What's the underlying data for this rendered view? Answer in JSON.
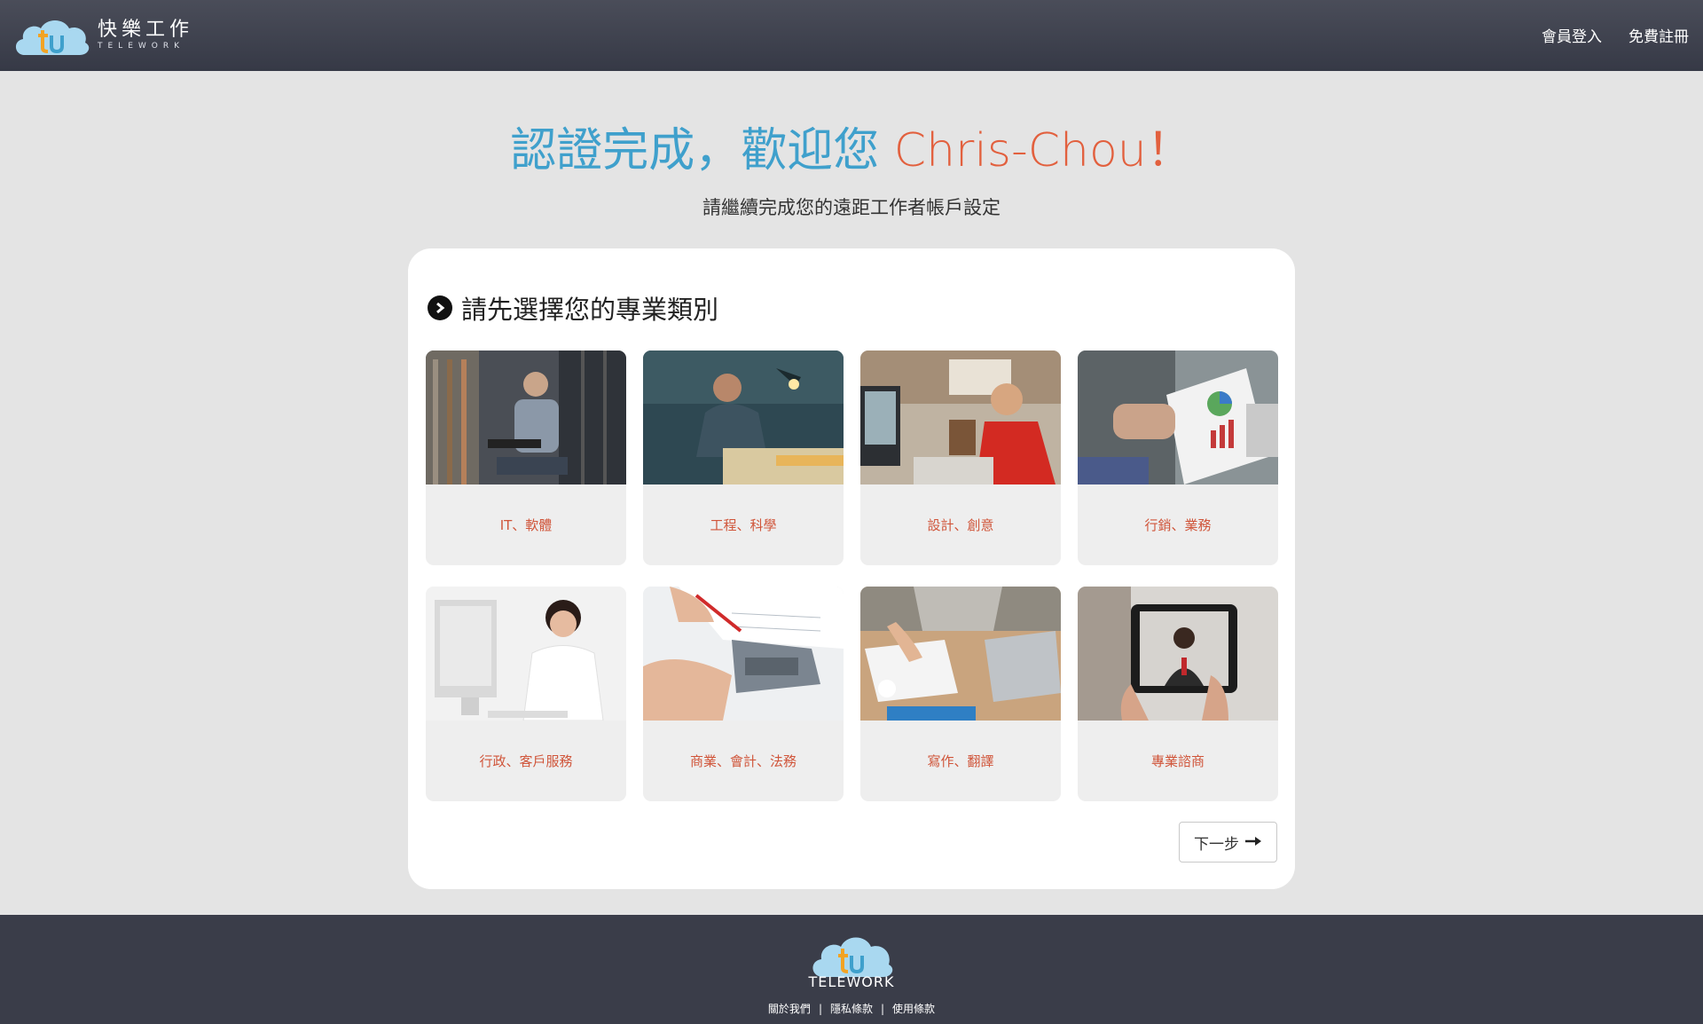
{
  "header": {
    "brand_cn": "快樂工作",
    "brand_en": "TELEWORK",
    "login": "會員登入",
    "register": "免費註冊"
  },
  "hero": {
    "title_prefix": "認證完成，歡迎您 ",
    "username": "Chris-Chou",
    "title_suffix": "！",
    "subtitle": "請繼續完成您的遠距工作者帳戶設定"
  },
  "panel": {
    "section_title": "請先選擇您的專業類別",
    "categories": [
      {
        "label": "IT、軟體",
        "image": "server-room-worker-photo"
      },
      {
        "label": "工程、科學",
        "image": "engineer-desk-lamp-photo"
      },
      {
        "label": "設計、創意",
        "image": "designer-at-desk-photo"
      },
      {
        "label": "行銷、業務",
        "image": "sales-charts-photo"
      },
      {
        "label": "行政、客戶服務",
        "image": "customer-service-woman-photo"
      },
      {
        "label": "商業、會計、法務",
        "image": "accounting-calculator-photo"
      },
      {
        "label": "寫作、翻譯",
        "image": "writing-notebook-laptop-photo"
      },
      {
        "label": "專業諮商",
        "image": "video-call-tablet-photo"
      }
    ],
    "next_label": "下一步"
  },
  "footer": {
    "brand": "TELEWORK",
    "links": [
      "關於我們",
      "隱私條款",
      "使用條款"
    ]
  },
  "colors": {
    "accent_blue": "#3fa0cc",
    "accent_orange": "#e2603e",
    "header_bg": "#3e4150",
    "category_text": "#d0553a"
  }
}
